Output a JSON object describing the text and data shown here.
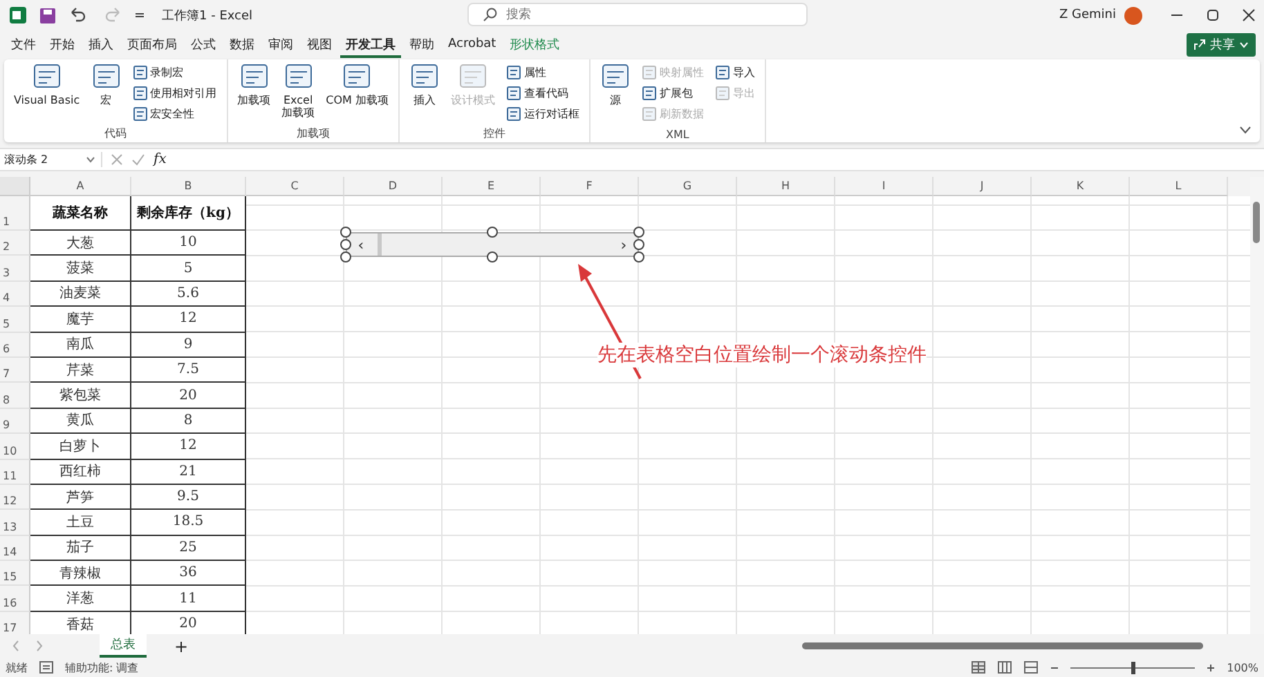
{
  "title_bar": {
    "title": "工作簿1 - Excel",
    "search": {
      "placeholder": "搜索"
    },
    "user": "Z Gemini"
  },
  "menu_tabs": [
    {
      "label": "文件",
      "selected": false,
      "kind": "normal"
    },
    {
      "label": "开始",
      "selected": false,
      "kind": "normal"
    },
    {
      "label": "插入",
      "selected": false,
      "kind": "normal"
    },
    {
      "label": "页面布局",
      "selected": false,
      "kind": "normal"
    },
    {
      "label": "公式",
      "selected": false,
      "kind": "normal"
    },
    {
      "label": "数据",
      "selected": false,
      "kind": "normal"
    },
    {
      "label": "审阅",
      "selected": false,
      "kind": "normal"
    },
    {
      "label": "视图",
      "selected": false,
      "kind": "normal"
    },
    {
      "label": "开发工具",
      "selected": true,
      "kind": "normal"
    },
    {
      "label": "帮助",
      "selected": false,
      "kind": "normal"
    },
    {
      "label": "Acrobat",
      "selected": false,
      "kind": "normal"
    },
    {
      "label": "形状格式",
      "selected": false,
      "kind": "contextual"
    }
  ],
  "share_button": {
    "label": "共享"
  },
  "ribbon_groups": [
    {
      "name": "代码",
      "items": [
        {
          "label": "Visual Basic",
          "kind": "large",
          "disabled": false
        },
        {
          "label": "宏",
          "kind": "large",
          "disabled": false
        },
        {
          "label": "录制宏",
          "kind": "small",
          "disabled": false
        },
        {
          "label": "使用相对引用",
          "kind": "small",
          "disabled": false
        },
        {
          "label": "宏安全性",
          "kind": "small",
          "disabled": false
        }
      ]
    },
    {
      "name": "加载项",
      "items": [
        {
          "label": "加载项",
          "kind": "large",
          "disabled": false
        },
        {
          "label": "Excel\n加载项",
          "kind": "large",
          "disabled": false
        },
        {
          "label": "COM 加载项",
          "kind": "large",
          "disabled": false
        }
      ]
    },
    {
      "name": "控件",
      "items": [
        {
          "label": "插入",
          "kind": "large",
          "disabled": false
        },
        {
          "label": "设计模式",
          "kind": "large",
          "disabled": true
        },
        {
          "label": "属性",
          "kind": "small",
          "disabled": false
        },
        {
          "label": "查看代码",
          "kind": "small",
          "disabled": false
        },
        {
          "label": "运行对话框",
          "kind": "small",
          "disabled": false
        }
      ]
    },
    {
      "name": "XML",
      "items": [
        {
          "label": "源",
          "kind": "large",
          "disabled": false
        },
        {
          "label": "映射属性",
          "kind": "small",
          "disabled": true
        },
        {
          "label": "扩展包",
          "kind": "small",
          "disabled": false
        },
        {
          "label": "刷新数据",
          "kind": "small",
          "disabled": true
        },
        {
          "label": "导入",
          "kind": "small",
          "disabled": false
        },
        {
          "label": "导出",
          "kind": "small",
          "disabled": true
        }
      ]
    }
  ],
  "formula_bar": {
    "name_box": "滚动条 2",
    "fx_label": "fx"
  },
  "sheet": {
    "columns": [
      "A",
      "B",
      "C",
      "D",
      "E",
      "F",
      "G",
      "H",
      "I",
      "J",
      "K",
      "L"
    ],
    "rows": [
      {
        "number": "1",
        "cells": [
          "蔬菜名称",
          "剩余库存（kg）"
        ]
      },
      {
        "number": "2",
        "cells": [
          "大葱",
          "10"
        ]
      },
      {
        "number": "3",
        "cells": [
          "菠菜",
          "5"
        ]
      },
      {
        "number": "4",
        "cells": [
          "油麦菜",
          "5.6"
        ]
      },
      {
        "number": "5",
        "cells": [
          "魔芋",
          "12"
        ]
      },
      {
        "number": "6",
        "cells": [
          "南瓜",
          "9"
        ]
      },
      {
        "number": "7",
        "cells": [
          "芹菜",
          "7.5"
        ]
      },
      {
        "number": "8",
        "cells": [
          "紫包菜",
          "20"
        ]
      },
      {
        "number": "9",
        "cells": [
          "黄瓜",
          "8"
        ]
      },
      {
        "number": "10",
        "cells": [
          "白萝卜",
          "12"
        ]
      },
      {
        "number": "11",
        "cells": [
          "西红柿",
          "21"
        ]
      },
      {
        "number": "12",
        "cells": [
          "芦笋",
          "9.5"
        ]
      },
      {
        "number": "13",
        "cells": [
          "土豆",
          "18.5"
        ]
      },
      {
        "number": "14",
        "cells": [
          "茄子",
          "25"
        ]
      },
      {
        "number": "15",
        "cells": [
          "青辣椒",
          "36"
        ]
      },
      {
        "number": "16",
        "cells": [
          "洋葱",
          "11"
        ]
      },
      {
        "number": "17",
        "cells": [
          "香菇",
          "20"
        ]
      }
    ],
    "scrollbar_control": {
      "left_arrow": "‹",
      "right_arrow": "›"
    },
    "annotation": "先在表格空白位置绘制一个滚动条控件"
  },
  "sheet_tabs": [
    {
      "label": "总表",
      "selected": true
    }
  ],
  "add_sheet": "+",
  "status_bar": {
    "status": "就绪",
    "accessibility": "辅助功能: 调查",
    "zoom": {
      "level": 0.5,
      "reading": "100%"
    }
  }
}
